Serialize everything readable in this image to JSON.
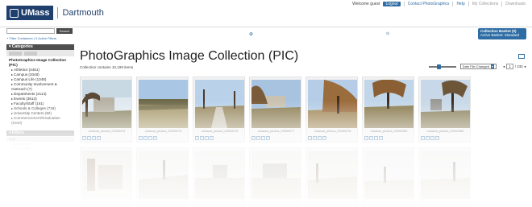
{
  "header": {
    "logo_text": "UMass",
    "logo_sub": "Dartmouth",
    "welcome": "Welcome guest",
    "logout": "Logout",
    "contact": "Contact PhotoGraphics",
    "help": "Help",
    "collections": "My Collections",
    "downloads": "Downloads"
  },
  "sidebar": {
    "search_placeholder": "",
    "search_button": "Search",
    "filter_links": "+ Filter Containers | 0 Active Filters",
    "categories_label": "Categories",
    "category_title": "PhotoGraphics Image Collection (PIC)",
    "categories": [
      "Athletics (4461)",
      "Campus (2048)",
      "Campus Life (1348)",
      "Community Involvement & Outreach (7)",
      "Departments (2114)",
      "Events (3613)",
      "Faculty/Staff (161)",
      "Schools & Colleges (719)",
      "University Centers (92)",
      "Commencement/Graduation (5340)"
    ],
    "filters_label": "Filters",
    "filter_year": "Year",
    "year_ranges": [
      "2000 - 2009",
      "2010 - 2013"
    ]
  },
  "main": {
    "basket_title": "Collection Basket (0)",
    "basket_sub": "Active Basket: Standard",
    "page_title": "PhotoGraphics Image Collection (PIC)",
    "count": "Collection contains 10,199 items",
    "sort_label": "Date File Changed",
    "page_current": "1",
    "page_total": "/ 232",
    "tiles": [
      {
        "caption": "umassd_photos_00000274"
      },
      {
        "caption": "umassd_photos_00000275"
      },
      {
        "caption": "umassd_photos_00000276"
      },
      {
        "caption": "umassd_photos_00000277"
      },
      {
        "caption": "umassd_photos_00000278"
      },
      {
        "caption": "umassd_photos_00000283"
      },
      {
        "caption": "umassd_photos_00000284"
      }
    ]
  },
  "colors": {
    "brand": "#1f3f6e",
    "accent": "#2e6da4"
  }
}
